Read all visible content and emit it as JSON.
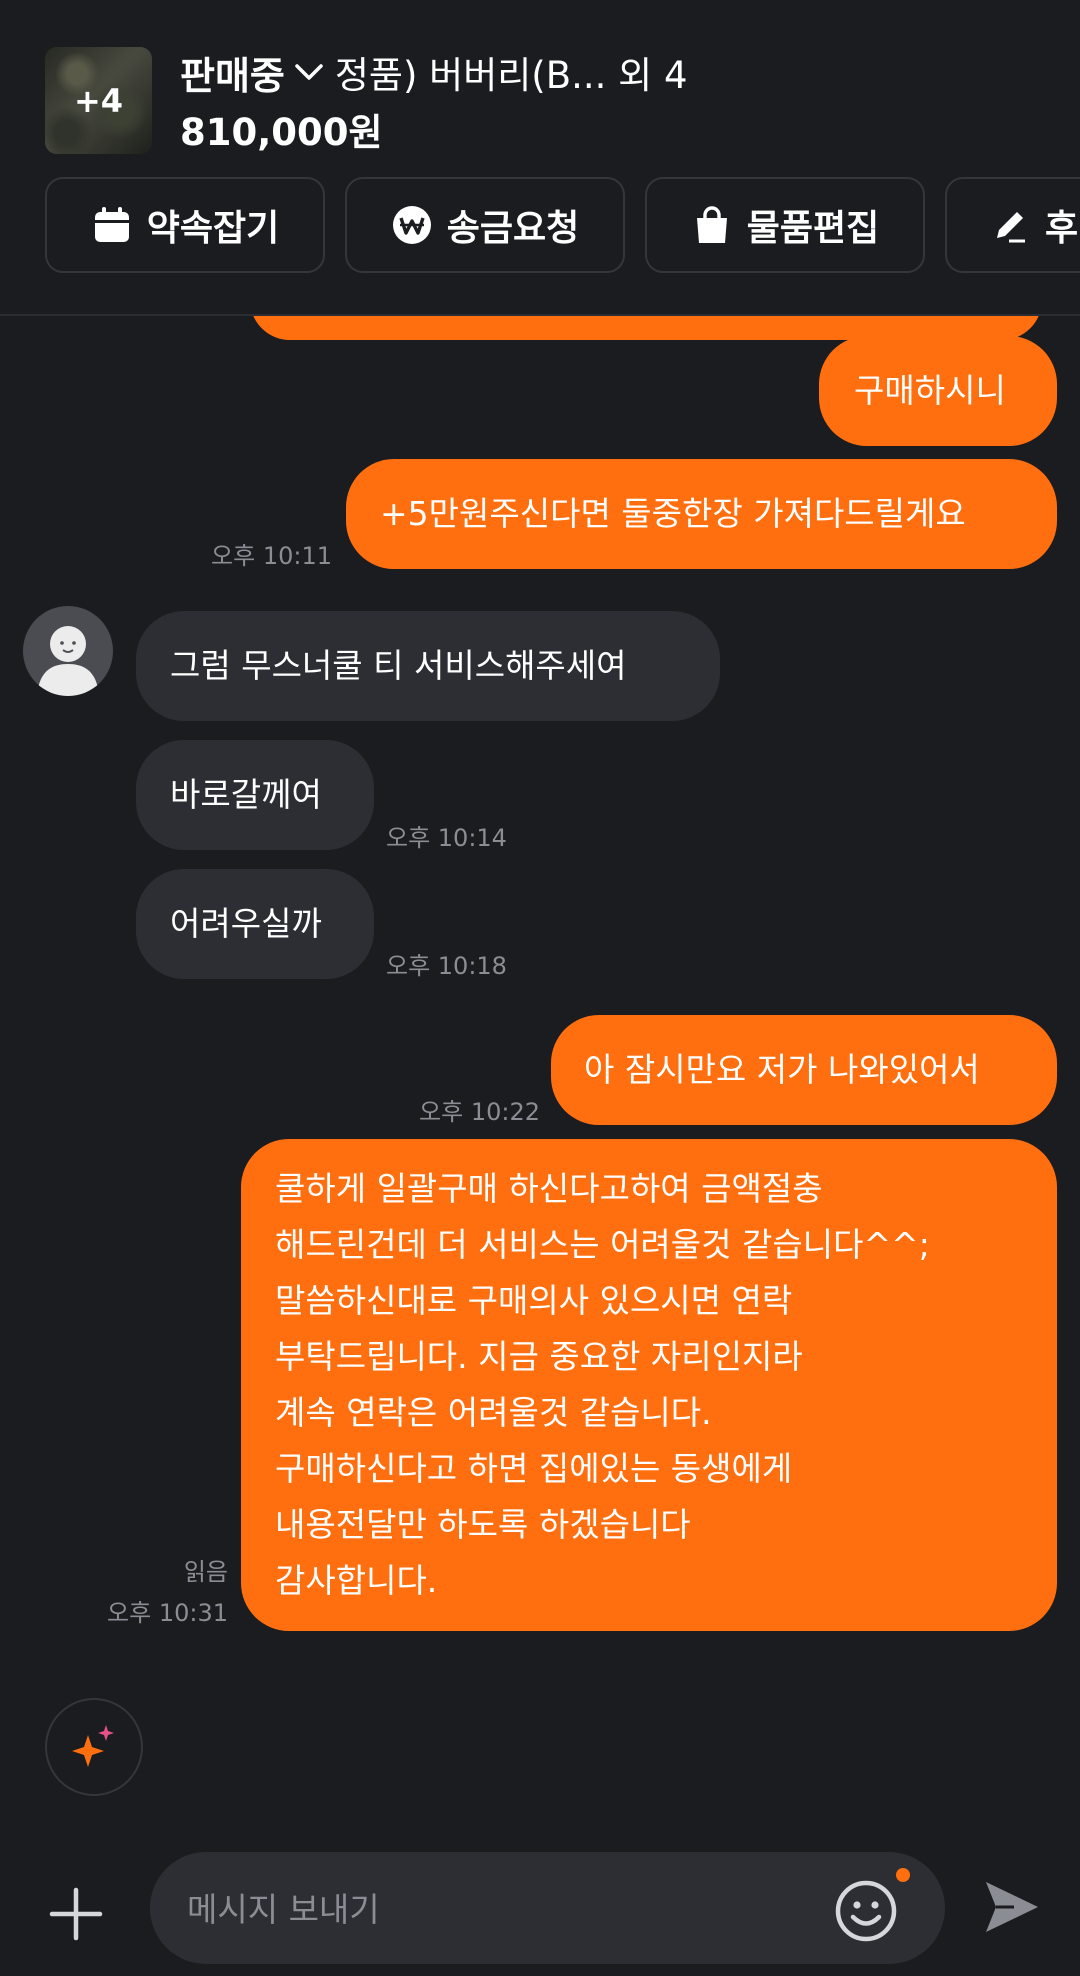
{
  "header": {
    "thumb_count": "+4",
    "status": "판매중",
    "product_title": "정품) 버버리(B... 외 4",
    "price": "810,000원",
    "actions": [
      {
        "label": "약속잡기",
        "icon": "calendar-icon"
      },
      {
        "label": "송금요청",
        "icon": "won-coin-icon"
      },
      {
        "label": "물품편집",
        "icon": "shopping-bag-icon"
      },
      {
        "label": "후",
        "icon": "pencil-icon"
      }
    ]
  },
  "messages": [
    {
      "dir": "out",
      "text": "구매하시니"
    },
    {
      "dir": "out",
      "text": "+5만원주신다면 둘중한장 가져다드릴게요",
      "time": "오후 10:11"
    },
    {
      "dir": "in",
      "text": "그럼 무스너쿨 티  서비스해주세여"
    },
    {
      "dir": "in",
      "text": "바로갈께여",
      "time": "오후 10:14"
    },
    {
      "dir": "in",
      "text": "어려우실까",
      "time": "오후 10:18"
    },
    {
      "dir": "out",
      "text": "아 잠시만요 저가 나와있어서",
      "time": "오후 10:22"
    },
    {
      "dir": "out",
      "lines": [
        "쿨하게 일괄구매 하신다고하여 금액절충",
        "해드린건데 더 서비스는 어려울것 같습니다^^;",
        "말씀하신대로 구매의사 있으시면 연락",
        "부탁드립니다. 지금 중요한 자리인지라",
        "계속 연락은 어려울것 같습니다.",
        "구매하신다고 하면 집에있는 동생에게",
        "내용전달만 하도록 하겠습니다",
        "감사합니다."
      ],
      "read": "읽음",
      "time": "오후 10:31"
    }
  ],
  "composer": {
    "placeholder": "메시지 보내기"
  },
  "colors": {
    "background": "#1b1c20",
    "outgoing_bubble": "#ff6f0f",
    "incoming_bubble": "#2d2e34",
    "meta_text": "#8b8d94"
  },
  "icons": [
    "plus-icon",
    "emoji-icon",
    "send-icon",
    "sparkle-icon",
    "chevron-down-icon"
  ]
}
